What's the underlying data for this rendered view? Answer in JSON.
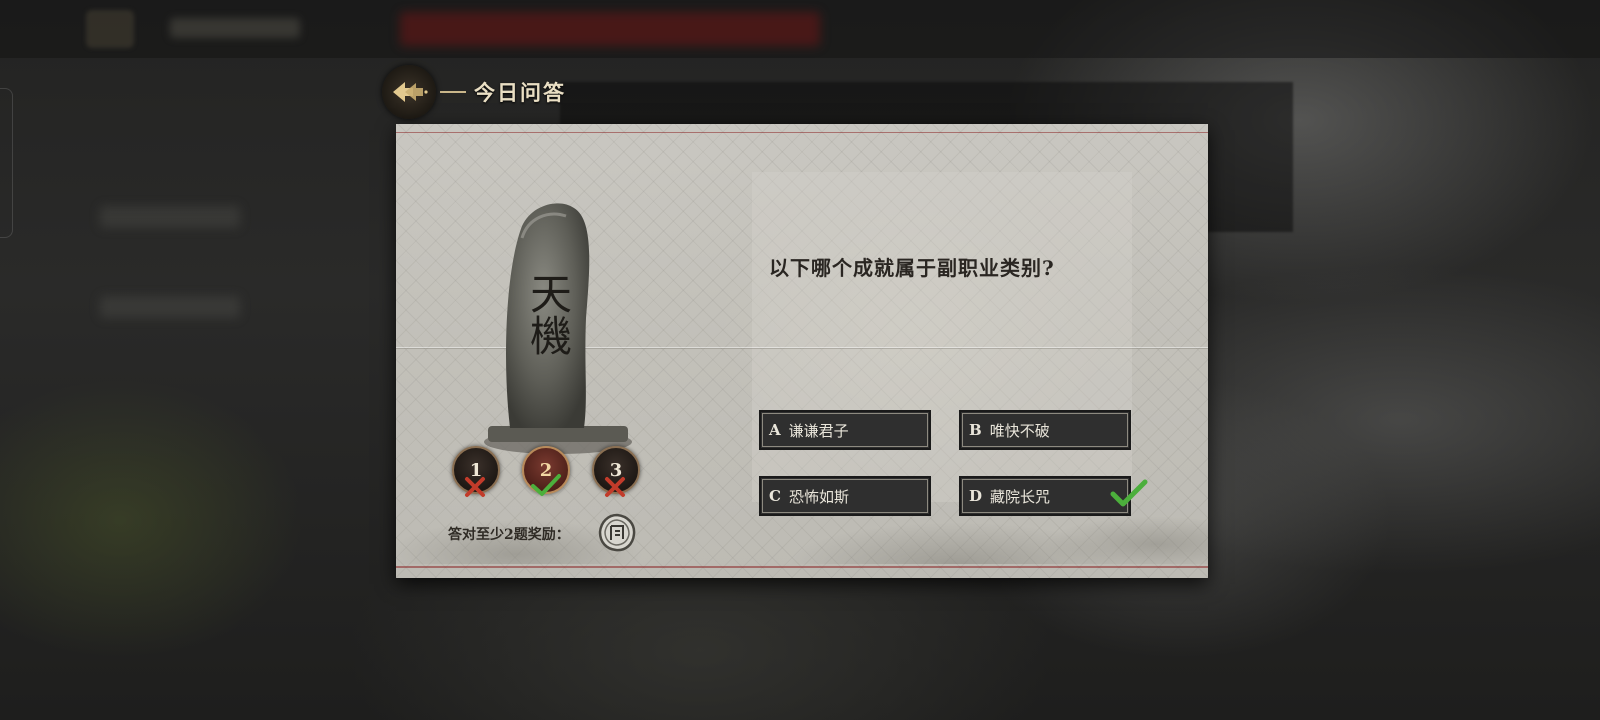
{
  "header": {
    "title": "今日问答"
  },
  "stele": {
    "inscription": "天機"
  },
  "progress": [
    {
      "number": "1",
      "result": "wrong"
    },
    {
      "number": "2",
      "result": "correct"
    },
    {
      "number": "3",
      "result": "wrong"
    }
  ],
  "reward": {
    "label": "答对至少2题奖励：",
    "icon": "reward-token-icon"
  },
  "question": {
    "text": "以下哪个成就属于副职业类别?",
    "options": [
      {
        "letter": "A",
        "text": "谦谦君子"
      },
      {
        "letter": "B",
        "text": "唯快不破"
      },
      {
        "letter": "C",
        "text": "恐怖如斯"
      },
      {
        "letter": "D",
        "text": "藏院长咒"
      }
    ],
    "correct_option": "D"
  },
  "colors": {
    "correct": "#4caf3c",
    "wrong": "#c23b2a",
    "accent_gold": "#c9b68a",
    "option_bg": "#2f2f2f"
  }
}
